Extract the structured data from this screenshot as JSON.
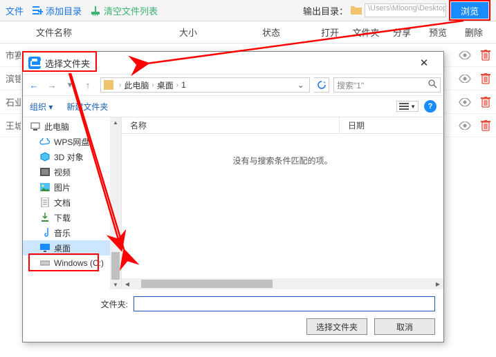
{
  "toolbar": {
    "add_dir": "添加目录",
    "clear_list": "清空文件列表",
    "output_dir_label": "输出目录：",
    "output_path": "\\Users\\Mloong\\Desktop\\",
    "browse": "浏览"
  },
  "list_header": {
    "name": "文件名称",
    "size": "大小",
    "status": "状态",
    "open": "打开",
    "folder": "文件夹",
    "share": "分享",
    "preview": "预览",
    "delete": "删除"
  },
  "rows": [
    {
      "name": "市赛"
    },
    {
      "name": "滨银"
    },
    {
      "name": "石业"
    },
    {
      "name": "王城"
    }
  ],
  "dialog": {
    "title": "选择文件夹",
    "breadcrumb": {
      "pc": "此电脑",
      "desktop": "桌面",
      "folder": "1"
    },
    "search_placeholder": "搜索\"1\"",
    "organize": "组织",
    "new_folder": "新建文件夹",
    "content_header": {
      "name": "名称",
      "date": "日期"
    },
    "empty_msg": "没有与搜索条件匹配的项。",
    "folder_label": "文件夹:",
    "select_btn": "选择文件夹",
    "cancel_btn": "取消",
    "tree": {
      "this_pc": "此电脑",
      "wps": "WPS网盘",
      "obj3d": "3D 对象",
      "video": "视频",
      "pic": "图片",
      "doc": "文档",
      "download": "下载",
      "music": "音乐",
      "desktop": "桌面",
      "windows_c": "Windows (C:)"
    }
  }
}
